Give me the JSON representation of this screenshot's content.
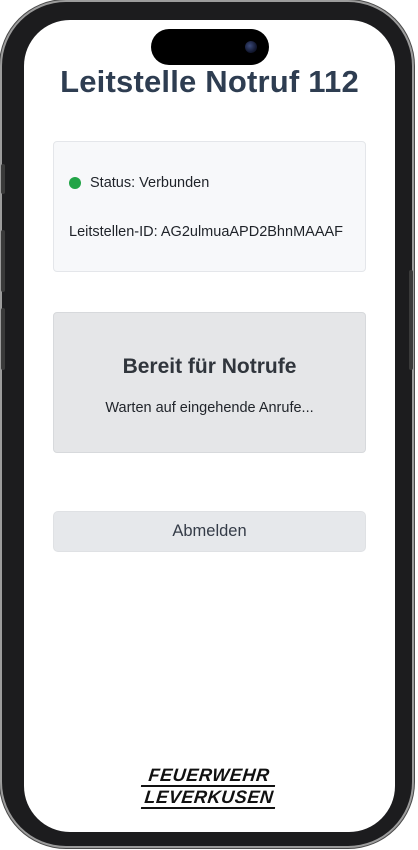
{
  "app": {
    "title": "Leitstelle Notruf 112"
  },
  "status_card": {
    "status_label": "Status: Verbunden",
    "status_color": "#22a447",
    "station_id": "Leitstellen-ID: AG2ulmuaAPD2BhnMAAAF"
  },
  "ready_panel": {
    "heading": "Bereit für Notrufe",
    "subtext": "Warten auf eingehende Anrufe..."
  },
  "actions": {
    "logout_label": "Abmelden"
  },
  "logo": {
    "line1": "FEUERWEHR",
    "line2": "LEVERKUSEN"
  },
  "theme": {
    "title_color": "#2e3d51",
    "panel_bg": "#e5e6e8",
    "card_bg": "#f7f8fa"
  }
}
